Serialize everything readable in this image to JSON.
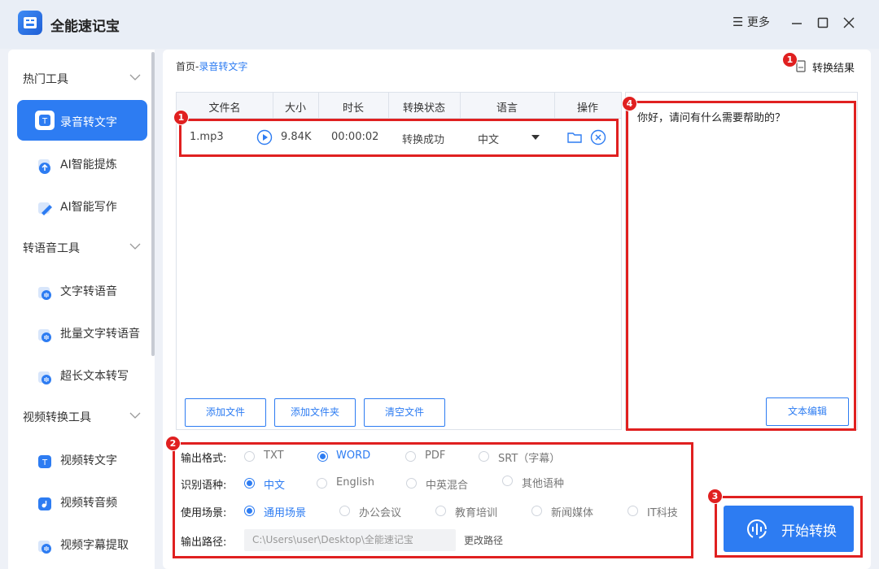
{
  "app": {
    "title": "全能速记宝",
    "more_label": "更多"
  },
  "sidebar": {
    "groups": [
      {
        "label": "热门工具"
      },
      {
        "label": "转语音工具"
      },
      {
        "label": "视频转换工具"
      }
    ],
    "items": [
      {
        "label": "录音转文字"
      },
      {
        "label": "AI智能提炼"
      },
      {
        "label": "AI智能写作"
      },
      {
        "label": "文字转语音"
      },
      {
        "label": "批量文字转语音"
      },
      {
        "label": "超长文本转写"
      },
      {
        "label": "视频转文字"
      },
      {
        "label": "视频转音频"
      },
      {
        "label": "视频字幕提取"
      }
    ]
  },
  "breadcrumb": {
    "home": "首页",
    "sep": "-",
    "current": "录音转文字"
  },
  "result_link": "转换结果",
  "table": {
    "headers": [
      "文件名",
      "大小",
      "时长",
      "转换状态",
      "语言",
      "操作"
    ],
    "rows": [
      {
        "name": "1.mp3",
        "size": "9.84K",
        "duration": "00:00:02",
        "status": "转换成功",
        "language": "中文"
      }
    ],
    "buttons": {
      "add_file": "添加文件",
      "add_folder": "添加文件夹",
      "clear": "清空文件"
    }
  },
  "preview": {
    "text": "你好，请问有什么需要帮助的？",
    "edit_button": "文本编辑"
  },
  "options": {
    "output_format": {
      "label": "输出格式:",
      "choices": [
        "TXT",
        "WORD",
        "PDF",
        "SRT（字幕）"
      ],
      "selected": "WORD"
    },
    "language": {
      "label": "识别语种:",
      "choices": [
        "中文",
        "English",
        "中英混合",
        "其他语种"
      ],
      "selected": "中文"
    },
    "scene": {
      "label": "使用场景:",
      "choices": [
        "通用场景",
        "办公会议",
        "教育培训",
        "新闻媒体",
        "IT科技"
      ],
      "selected": "通用场景"
    },
    "path": {
      "label": "输出路径:",
      "value": "C:\\Users\\user\\Desktop\\全能速记宝",
      "change": "更改路径"
    }
  },
  "start_button": "开始转换",
  "annotations": [
    "1",
    "1",
    "2",
    "3",
    "4"
  ],
  "colors": {
    "accent": "#2d7cf2",
    "annotation": "#e02020"
  }
}
